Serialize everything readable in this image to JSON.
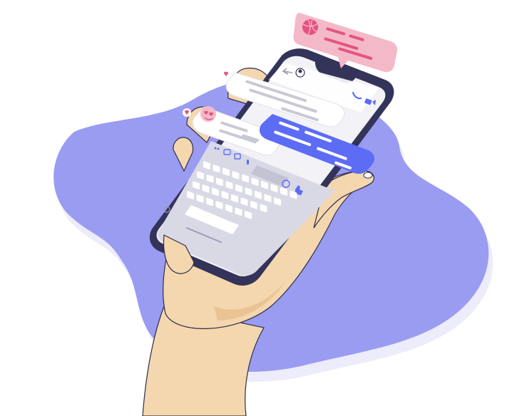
{
  "illustration": {
    "subject": "hand-holding-smartphone-messaging",
    "colors": {
      "background": "#ffffff",
      "blob": "#9a9cf2",
      "blob_shadow": "#ececfa",
      "skin": "#f4d7ae",
      "skin_shadow": "#e9c394",
      "skin_line": "#2f2c4a",
      "phone_frame": "#34335a",
      "screen": "#f2f2f7",
      "keyboard_bg": "#d9d9e6",
      "key": "#ffffff",
      "bubble_gray": "#e8e8ee",
      "bubble_blue": "#5d6cf4",
      "bubble_pink": "#f4b9c9",
      "pink_accent": "#e5537f",
      "text_line_gray": "#c9c9d6",
      "text_line_white": "#ffffff"
    },
    "icons": [
      "basketball-icon",
      "heart-eyes-emoji-icon",
      "back-arrow-icon",
      "phone-call-icon",
      "video-camera-icon",
      "camera-icon",
      "image-icon",
      "microphone-icon",
      "emoji-icon",
      "thumbs-up-icon",
      "heart-reaction-icon",
      "avatar-icon"
    ]
  }
}
